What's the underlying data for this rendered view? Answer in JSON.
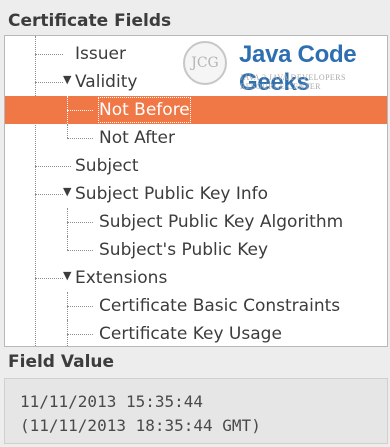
{
  "certificate_fields": {
    "label": "Certificate Fields",
    "rows": [
      {
        "label": "Issuer",
        "expander": ""
      },
      {
        "label": "Validity",
        "expander": "▼"
      },
      {
        "label": "Not Before",
        "expander": "",
        "selected": true
      },
      {
        "label": "Not After",
        "expander": ""
      },
      {
        "label": "Subject",
        "expander": ""
      },
      {
        "label": "Subject Public Key Info",
        "expander": "▼"
      },
      {
        "label": "Subject Public Key Algorithm",
        "expander": ""
      },
      {
        "label": "Subject's Public Key",
        "expander": ""
      },
      {
        "label": "Extensions",
        "expander": "▼"
      },
      {
        "label": "Certificate Basic Constraints",
        "expander": ""
      },
      {
        "label": "Certificate Key Usage",
        "expander": ""
      }
    ]
  },
  "watermark": {
    "badge": "JCG",
    "title": "Java Code Geeks",
    "subtitle": "JAVA 2 JAVA DEVELOPERS RESOURCE CENTER"
  },
  "field_value": {
    "label": "Field Value",
    "lines": [
      "11/11/2013 15:35:44",
      "(11/11/2013 18:35:44 GMT)"
    ]
  },
  "colors": {
    "selection": "#f07746",
    "logo_blue": "#2d6fb0"
  }
}
